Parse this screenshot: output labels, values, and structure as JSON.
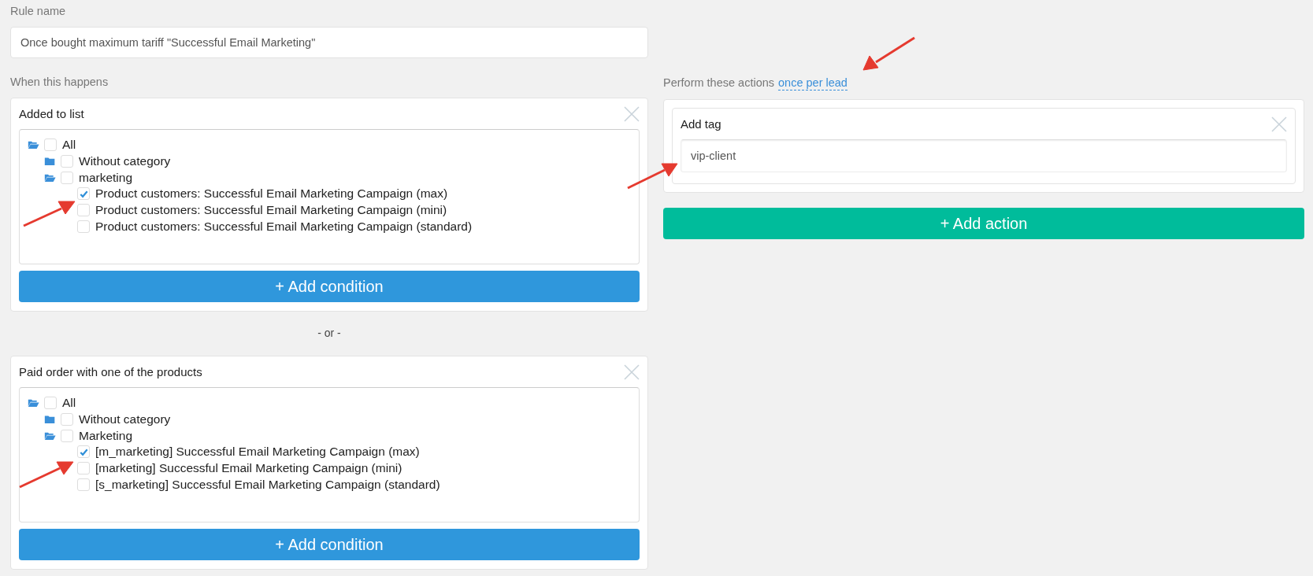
{
  "rule_name": {
    "label": "Rule name",
    "value": "Once bought maximum tariff \"Successful Email Marketing\""
  },
  "conditions_label": "When this happens",
  "conditions": [
    {
      "title": "Added to list",
      "tree": [
        {
          "label": "All",
          "kind": "folder",
          "expanded": true,
          "checked": false,
          "children": [
            {
              "label": "Without category",
              "kind": "folder",
              "expanded": false,
              "checked": false
            },
            {
              "label": "marketing",
              "kind": "folder",
              "expanded": true,
              "checked": false,
              "children": [
                {
                  "label": "Product customers: Successful Email Marketing Campaign (max)",
                  "kind": "item",
                  "checked": true
                },
                {
                  "label": "Product customers: Successful Email Marketing Campaign (mini)",
                  "kind": "item",
                  "checked": false
                },
                {
                  "label": "Product customers: Successful Email Marketing Campaign (standard)",
                  "kind": "item",
                  "checked": false
                }
              ]
            }
          ]
        }
      ],
      "button": "+ Add condition"
    },
    {
      "title": "Paid order with one of the products",
      "tree": [
        {
          "label": "All",
          "kind": "folder",
          "expanded": true,
          "checked": false,
          "children": [
            {
              "label": "Without category",
              "kind": "folder",
              "expanded": false,
              "checked": false
            },
            {
              "label": "Marketing",
              "kind": "folder",
              "expanded": true,
              "checked": false,
              "children": [
                {
                  "label": "[m_marketing] Successful Email Marketing Campaign (max)",
                  "kind": "item",
                  "checked": true
                },
                {
                  "label": "[marketing] Successful Email Marketing Campaign (mini)",
                  "kind": "item",
                  "checked": false
                },
                {
                  "label": "[s_marketing] Successful Email Marketing Campaign (standard)",
                  "kind": "item",
                  "checked": false
                }
              ]
            }
          ]
        }
      ],
      "button": "+ Add condition"
    }
  ],
  "separator": "- or -",
  "actions_label": "Perform these actions",
  "actions_mode_link": "once per lead",
  "actions": [
    {
      "title": "Add tag",
      "value": "vip-client"
    }
  ],
  "add_action_button": "+ Add action"
}
